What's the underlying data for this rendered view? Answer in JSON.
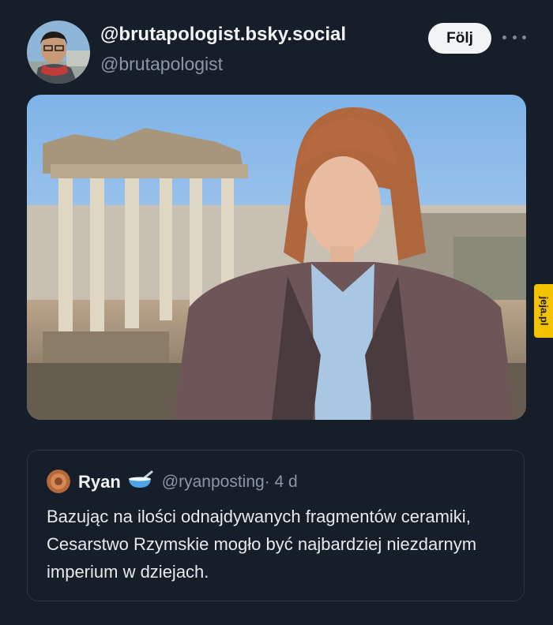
{
  "post": {
    "display_name": "@brutapologist.bsky.social",
    "handle": "@brutapologist",
    "follow_label": "Följ",
    "more_icon": "more-horizontal-icon"
  },
  "watermark": {
    "text": "jeja.pl",
    "color": "#f4c300"
  },
  "quote": {
    "name": "Ryan",
    "emoji_icon": "bowl-with-spoon-icon",
    "handle": "@ryanposting",
    "time": "· 4 d",
    "text": "Bazując na ilości odnajdywanych fragmentów ceramiki, Cesarstwo Rzymskie mogło być najbardziej niezdarnym imperium w dziejach."
  },
  "colors": {
    "background": "#161e29",
    "text": "#e7e9ea",
    "muted": "#8a97a6",
    "button": "#f1f3f5"
  }
}
